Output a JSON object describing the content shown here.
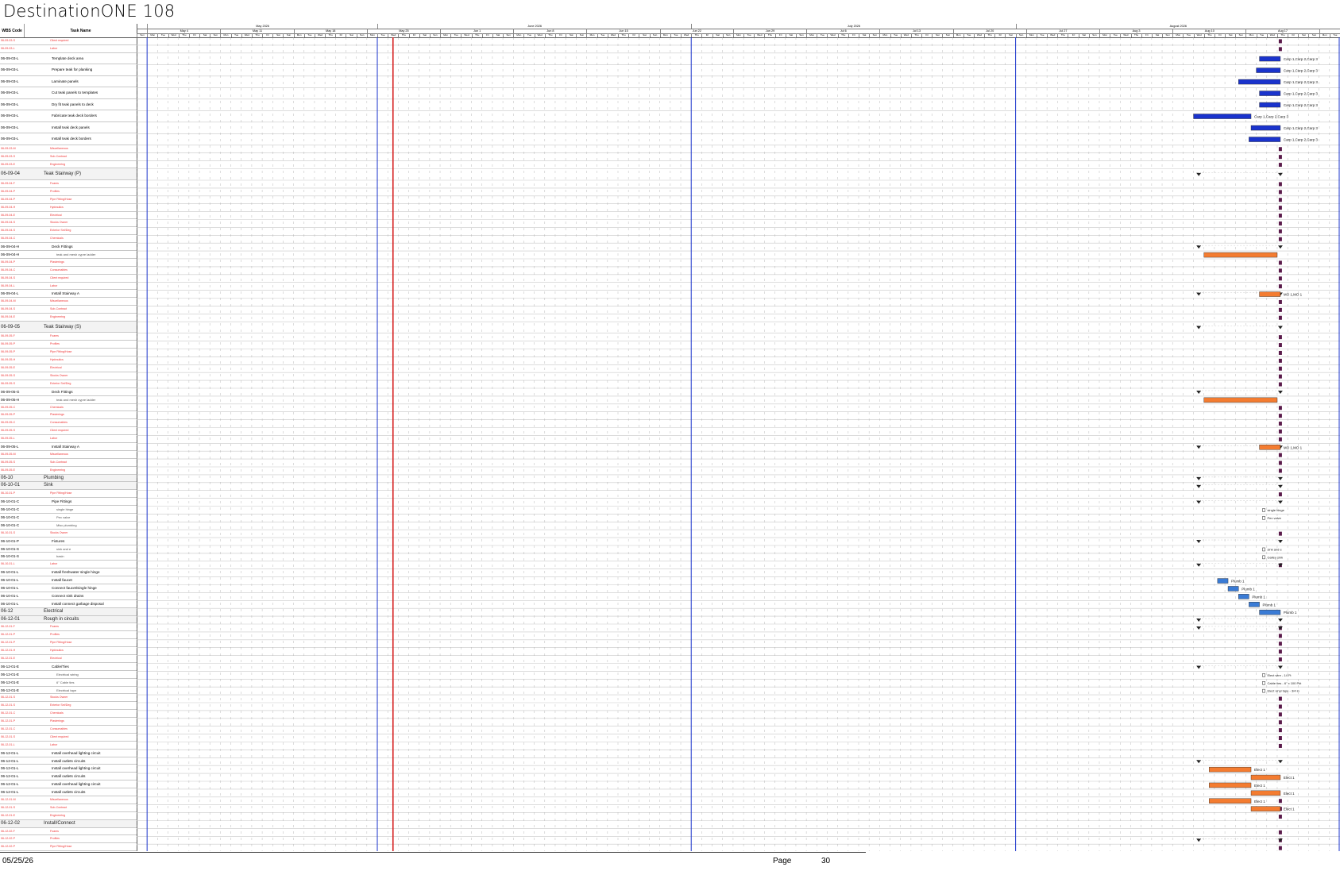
{
  "title": "DestinationONE 108",
  "header": {
    "wbs_label": "WBS Code",
    "name_label": "Task Name"
  },
  "months": [
    {
      "label": "May 2026",
      "start": 0,
      "span": 22
    },
    {
      "label": "June 2026",
      "start": 22,
      "span": 30
    },
    {
      "label": "July 2026",
      "start": 52,
      "span": 31
    },
    {
      "label": "August 2026",
      "start": 83,
      "span": 31
    }
  ],
  "weeks": [
    "May 4",
    "May 11",
    "May 18",
    "May 25",
    "Jun 1",
    "Jun 8",
    "Jun 15",
    "Jun 22",
    "Jun 29",
    "Jul 6",
    "Jul 13",
    "Jul 20",
    "Jul 27",
    "Aug 3",
    "Aug 10",
    "Aug 17",
    "Aug 24"
  ],
  "day_labels": [
    "Mon",
    "Tue",
    "Wed",
    "Thu",
    "Fri",
    "Sat",
    "Sun"
  ],
  "rows": [
    {
      "wbs": "06-09-03-S",
      "name": "Client required",
      "style": "red"
    },
    {
      "wbs": "06-09-03-L",
      "name": "Labor",
      "style": "red"
    },
    {
      "wbs": "06-09-03-L",
      "name": "Template deck area",
      "style": "task",
      "big": true
    },
    {
      "wbs": "06-09-03-L",
      "name": "Prepare teak for planking",
      "style": "task",
      "big": true
    },
    {
      "wbs": "06-09-03-L",
      "name": "Laminate panels",
      "style": "task",
      "big": true
    },
    {
      "wbs": "06-09-03-L",
      "name": "Cut teak panels to templates",
      "style": "task",
      "big": true
    },
    {
      "wbs": "06-09-03-L",
      "name": "Dry fit teak panels to deck",
      "style": "task",
      "big": true
    },
    {
      "wbs": "06-09-03-L",
      "name": "Fabricate teak deck borders",
      "style": "task",
      "big": true
    },
    {
      "wbs": "06-09-03-L",
      "name": "Install teak deck panels",
      "style": "task",
      "big": true
    },
    {
      "wbs": "06-09-03-L",
      "name": "Install teak deck borders",
      "style": "task",
      "big": true
    },
    {
      "wbs": "06-09-03-M",
      "name": "Miscellaneous",
      "style": "red"
    },
    {
      "wbs": "06-09-03-S",
      "name": "Sub-Contract",
      "style": "red"
    },
    {
      "wbs": "06-09-03-E",
      "name": "Engineering",
      "style": "red"
    },
    {
      "wbs": "06-09-04",
      "name": "Teak Stairway (P)",
      "style": "summ",
      "big": true
    },
    {
      "wbs": "06-09-04-F",
      "name": "Foams",
      "style": "red"
    },
    {
      "wbs": "06-09-04-P",
      "name": "Profiles",
      "style": "red"
    },
    {
      "wbs": "06-09-04-P",
      "name": "Pipe Fitting/Hose",
      "style": "red"
    },
    {
      "wbs": "06-09-04-H",
      "name": "Hydraulics",
      "style": "red"
    },
    {
      "wbs": "06-09-04-E",
      "name": "Electrical",
      "style": "red"
    },
    {
      "wbs": "06-09-04-S",
      "name": "Stocks Owner",
      "style": "red"
    },
    {
      "wbs": "06-09-04-S",
      "name": "Exterior Set/Deg",
      "style": "red"
    },
    {
      "wbs": "06-09-04-C",
      "name": "Chemicals",
      "style": "red"
    },
    {
      "wbs": "06-09-04-H",
      "name": "Deck Fittings",
      "style": "task"
    },
    {
      "wbs": "06-09-04-H",
      "name": "teak and mesh cypre ladder",
      "style": "sub"
    },
    {
      "wbs": "06-09-04-P",
      "name": "Plasterings",
      "style": "red"
    },
    {
      "wbs": "06-09-04-C",
      "name": "Consumables",
      "style": "red"
    },
    {
      "wbs": "06-09-04-S",
      "name": "Client required",
      "style": "red"
    },
    {
      "wbs": "06-09-04-L",
      "name": "Labor",
      "style": "red"
    },
    {
      "wbs": "06-09-04-L",
      "name": "Install Stairway A",
      "style": "task"
    },
    {
      "wbs": "06-09-04-M",
      "name": "Miscellaneous",
      "style": "red"
    },
    {
      "wbs": "06-09-04-S",
      "name": "Sub-Contract",
      "style": "red"
    },
    {
      "wbs": "06-09-04-E",
      "name": "Engineering",
      "style": "red"
    },
    {
      "wbs": "06-09-05",
      "name": "Teak Stairway (S)",
      "style": "summ",
      "big": true
    },
    {
      "wbs": "06-09-05-F",
      "name": "Foams",
      "style": "red"
    },
    {
      "wbs": "06-09-05-P",
      "name": "Profiles",
      "style": "red"
    },
    {
      "wbs": "06-09-05-P",
      "name": "Pipe Fitting/Hose",
      "style": "red"
    },
    {
      "wbs": "06-09-05-H",
      "name": "Hydraulics",
      "style": "red"
    },
    {
      "wbs": "06-09-05-E",
      "name": "Electrical",
      "style": "red"
    },
    {
      "wbs": "06-09-05-S",
      "name": "Stocks Owner",
      "style": "red"
    },
    {
      "wbs": "06-09-05-S",
      "name": "Exterior Set/Deg",
      "style": "red"
    },
    {
      "wbs": "06-09-05-G",
      "name": "Deck Fittings",
      "style": "task"
    },
    {
      "wbs": "06-09-05-H",
      "name": "teak and mesh cypre ladder",
      "style": "sub"
    },
    {
      "wbs": "06-09-05-C",
      "name": "Chemicals",
      "style": "red"
    },
    {
      "wbs": "06-09-05-P",
      "name": "Plasterings",
      "style": "red"
    },
    {
      "wbs": "06-09-05-C",
      "name": "Consumables",
      "style": "red"
    },
    {
      "wbs": "06-09-05-S",
      "name": "Client required",
      "style": "red"
    },
    {
      "wbs": "06-09-05-L",
      "name": "Labor",
      "style": "red"
    },
    {
      "wbs": "06-09-05-L",
      "name": "Install Stairway A",
      "style": "task"
    },
    {
      "wbs": "06-09-05-M",
      "name": "Miscellaneous",
      "style": "red"
    },
    {
      "wbs": "06-09-05-S",
      "name": "Sub-Contract",
      "style": "red"
    },
    {
      "wbs": "06-09-05-E",
      "name": "Engineering",
      "style": "red"
    },
    {
      "wbs": "06-10",
      "name": "Plumbing",
      "style": "summ"
    },
    {
      "wbs": "06-10-01",
      "name": "Sink",
      "style": "summ"
    },
    {
      "wbs": "06-10-01-P",
      "name": "Pipe Fitting/Hose",
      "style": "red"
    },
    {
      "wbs": "06-10-01-C",
      "name": "Pipe Fittings",
      "style": "task"
    },
    {
      "wbs": "06-10-01-C",
      "name": "single hinge",
      "style": "sub"
    },
    {
      "wbs": "06-10-01-C",
      "name": "Pex valve",
      "style": "sub"
    },
    {
      "wbs": "06-10-01-C",
      "name": "Misc plumbing",
      "style": "sub"
    },
    {
      "wbs": "06-10-01-S",
      "name": "Stocks Owner",
      "style": "red"
    },
    {
      "wbs": "06-10-01-P",
      "name": "Fixtures",
      "style": "task"
    },
    {
      "wbs": "06-10-01-S",
      "name": "sink and e",
      "style": "sub"
    },
    {
      "wbs": "06-10-01-S",
      "name": "basin",
      "style": "sub"
    },
    {
      "wbs": "06-10-01-L",
      "name": "Labor",
      "style": "red"
    },
    {
      "wbs": "06-10-01-L",
      "name": "Install freshwater single hinge",
      "style": "task"
    },
    {
      "wbs": "06-10-01-L",
      "name": "Install faucet",
      "style": "task"
    },
    {
      "wbs": "06-10-01-L",
      "name": "Connect faucet/single hinge",
      "style": "task"
    },
    {
      "wbs": "06-10-01-L",
      "name": "Connect sink drains",
      "style": "task"
    },
    {
      "wbs": "06-10-01-L",
      "name": "Install connect garbage disposal",
      "style": "task"
    },
    {
      "wbs": "06-12",
      "name": "Electrical",
      "style": "summ"
    },
    {
      "wbs": "06-12-01",
      "name": "Rough in circuits",
      "style": "summ"
    },
    {
      "wbs": "06-12-01-F",
      "name": "Foams",
      "style": "red"
    },
    {
      "wbs": "06-12-01-P",
      "name": "Profiles",
      "style": "red"
    },
    {
      "wbs": "06-12-01-P",
      "name": "Pipe Fitting/Hose",
      "style": "red"
    },
    {
      "wbs": "06-12-01-H",
      "name": "Hydraulics",
      "style": "red"
    },
    {
      "wbs": "06-12-01-E",
      "name": "Electrical",
      "style": "red"
    },
    {
      "wbs": "06-12-01-E",
      "name": "Cable/Ties",
      "style": "task"
    },
    {
      "wbs": "06-12-01-E",
      "name": "Electrical wiring",
      "style": "sub"
    },
    {
      "wbs": "06-12-01-E",
      "name": "6\" Cable ties",
      "style": "sub"
    },
    {
      "wbs": "06-12-01-E",
      "name": "Electrical tape",
      "style": "sub"
    },
    {
      "wbs": "06-12-01-S",
      "name": "Stocks Owner",
      "style": "red"
    },
    {
      "wbs": "06-12-01-S",
      "name": "Exterior Set/Deg",
      "style": "red"
    },
    {
      "wbs": "06-12-01-C",
      "name": "Chemicals",
      "style": "red"
    },
    {
      "wbs": "06-12-01-P",
      "name": "Plasterings",
      "style": "red"
    },
    {
      "wbs": "06-12-01-C",
      "name": "Consumables",
      "style": "red"
    },
    {
      "wbs": "06-12-01-S",
      "name": "Client required",
      "style": "red"
    },
    {
      "wbs": "06-12-01-L",
      "name": "Labor",
      "style": "red"
    },
    {
      "wbs": "06-12-01-L",
      "name": "Install overhead lighting circuit",
      "style": "task"
    },
    {
      "wbs": "06-12-01-L",
      "name": "Install outlets circuits",
      "style": "task"
    },
    {
      "wbs": "06-12-01-L",
      "name": "Install overhead lighting circuit",
      "style": "task"
    },
    {
      "wbs": "06-12-01-L",
      "name": "Install outlets circuits",
      "style": "task"
    },
    {
      "wbs": "06-12-01-L",
      "name": "Install overhead lighting circuit",
      "style": "task"
    },
    {
      "wbs": "06-12-01-L",
      "name": "Install outlets circuits",
      "style": "task"
    },
    {
      "wbs": "06-12-01-M",
      "name": "Miscellaneous",
      "style": "red"
    },
    {
      "wbs": "06-12-01-S",
      "name": "Sub-Contract",
      "style": "red"
    },
    {
      "wbs": "06-12-01-E",
      "name": "Engineering",
      "style": "red"
    },
    {
      "wbs": "06-12-02",
      "name": "Install/Connect",
      "style": "summ"
    },
    {
      "wbs": "06-12-02-F",
      "name": "Foams",
      "style": "red"
    },
    {
      "wbs": "06-12-02-P",
      "name": "Profiles",
      "style": "red"
    },
    {
      "wbs": "06-12-02-P",
      "name": "Pipe Fitting/Hose",
      "style": "red"
    }
  ],
  "bars": [
    {
      "row": 2,
      "start": 106.3,
      "end": 108.3,
      "color": "#1a33cc",
      "label": "Carp 1,Carp 2,Carp 3"
    },
    {
      "row": 3,
      "start": 106,
      "end": 108.3,
      "color": "#1a33cc",
      "label": "Carp 1,Carp 2,Carp 3"
    },
    {
      "row": 4,
      "start": 104.3,
      "end": 108.3,
      "color": "#1a33cc",
      "label": "Carp 1,Carp 2,Carp 3"
    },
    {
      "row": 5,
      "start": 106.3,
      "end": 108.3,
      "color": "#1a33cc",
      "label": "Carp 1,Carp 2,Carp 3"
    },
    {
      "row": 6,
      "start": 106.3,
      "end": 108.3,
      "color": "#1a33cc",
      "label": "Carp 1,Carp 2,Carp 3"
    },
    {
      "row": 7,
      "start": 100,
      "end": 105.5,
      "color": "#1a33cc",
      "label": "Carp 1,Carp 2,Carp 3"
    },
    {
      "row": 8,
      "start": 105.5,
      "end": 108.3,
      "color": "#1a33cc",
      "label": "Carp 1,Carp 2,Carp 3"
    },
    {
      "row": 9,
      "start": 105.3,
      "end": 108.3,
      "color": "#1a33cc",
      "label": "Carp 1,Carp 2,Carp 3"
    },
    {
      "row": 23,
      "start": 101,
      "end": 108,
      "color": "#f47c30",
      "label": ""
    },
    {
      "row": 28,
      "start": 106.3,
      "end": 108.3,
      "color": "#f47c30",
      "label": "MO 1,MO 1"
    },
    {
      "row": 41,
      "start": 101,
      "end": 108,
      "color": "#f47c30",
      "label": ""
    },
    {
      "row": 47,
      "start": 106.3,
      "end": 108.3,
      "color": "#f47c30",
      "label": "MO 1,MO 1"
    },
    {
      "row": 64,
      "start": 102.3,
      "end": 103.3,
      "color": "#3a7bd5",
      "label": "Plumb 1"
    },
    {
      "row": 65,
      "start": 103.3,
      "end": 104.3,
      "color": "#3a7bd5",
      "label": "Plumb 1"
    },
    {
      "row": 66,
      "start": 104.3,
      "end": 105.3,
      "color": "#3a7bd5",
      "label": "Plumb 1"
    },
    {
      "row": 67,
      "start": 105.3,
      "end": 106.3,
      "color": "#3a7bd5",
      "label": "Plumb 1"
    },
    {
      "row": 68,
      "start": 106.3,
      "end": 108.3,
      "color": "#3a7bd5",
      "label": "Plumb 1"
    },
    {
      "row": 88,
      "start": 101.5,
      "end": 105.5,
      "color": "#f47c30",
      "label": "Elect 1"
    },
    {
      "row": 89,
      "start": 105.5,
      "end": 108.3,
      "color": "#f47c30",
      "label": "Elect 1"
    },
    {
      "row": 90,
      "start": 101.5,
      "end": 105.5,
      "color": "#f47c30",
      "label": "Elect 1"
    },
    {
      "row": 91,
      "start": 105.5,
      "end": 108.3,
      "color": "#f47c30",
      "label": "Elect 1"
    },
    {
      "row": 92,
      "start": 101.5,
      "end": 105.5,
      "color": "#f47c30",
      "label": "Elect 1"
    },
    {
      "row": 93,
      "start": 105.5,
      "end": 108.3,
      "color": "#f47c30",
      "label": "Elect 1"
    }
  ],
  "summaries": [
    13,
    22,
    28,
    32,
    40,
    47,
    51,
    52,
    54,
    59,
    62,
    69,
    70,
    75,
    87,
    97
  ],
  "milestone_labels": [
    {
      "row": 55,
      "text": "single hinge"
    },
    {
      "row": 56,
      "text": "Pex valve"
    },
    {
      "row": 60,
      "text": "sink and e"
    },
    {
      "row": 61,
      "text": "Galley sink"
    },
    {
      "row": 76,
      "text": "Elect wire - 14 Ft"
    },
    {
      "row": 77,
      "text": "Cable ties - 6\" x 100 Pkt"
    },
    {
      "row": 78,
      "text": "Elect vinyl tape - 3/4 in"
    }
  ],
  "colors": {
    "today": "#d62020",
    "week_line": "#1a33cc",
    "grid": "#c8c8c8",
    "marker": "#5a1a4a"
  },
  "footer": {
    "date": "05/25/26",
    "page_label": "Page",
    "page_number": "30"
  }
}
